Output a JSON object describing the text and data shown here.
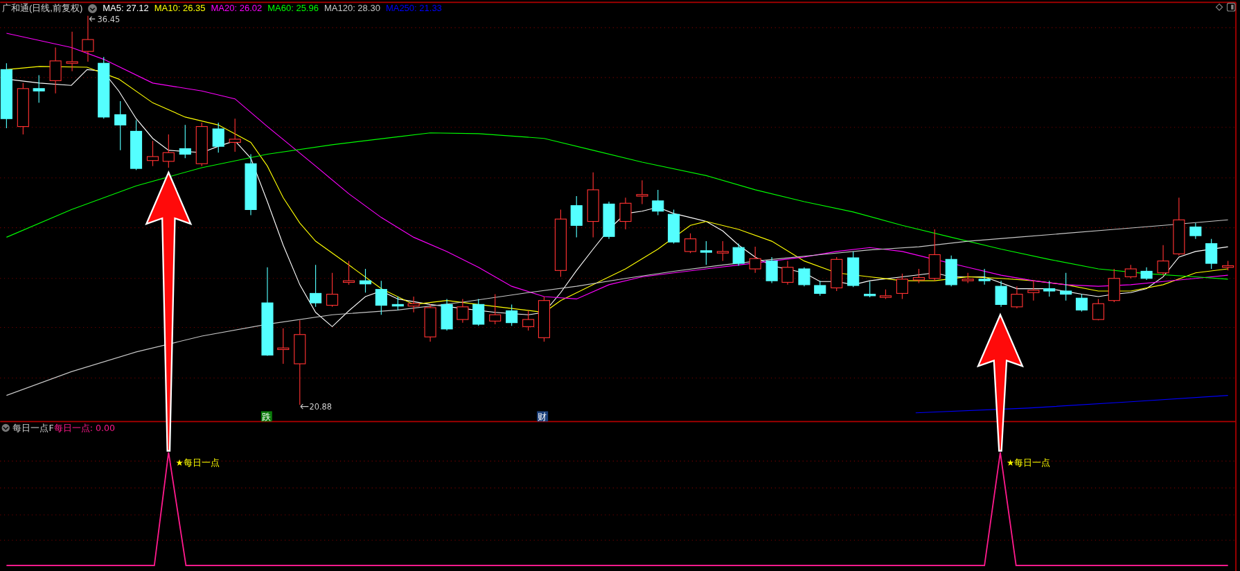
{
  "chart": {
    "title": "广和通(日线,前复权)",
    "ma_legend": [
      {
        "label": "MA5: 27.12",
        "color": "#ffffff"
      },
      {
        "label": "MA10: 26.35",
        "color": "#ffff00"
      },
      {
        "label": "MA20: 26.02",
        "color": "#ff00ff"
      },
      {
        "label": "MA60: 25.96",
        "color": "#00ff00"
      },
      {
        "label": "MA120: 28.30",
        "color": "#c8c8c8"
      },
      {
        "label": "MA250: 21.33",
        "color": "#0000ff"
      }
    ],
    "high_label": "36.45",
    "low_label": "20.88",
    "event_markers": [
      {
        "text": "跌",
        "color": "#0a7a0a"
      },
      {
        "text": "财",
        "color": "#1a3f7a"
      }
    ]
  },
  "indicator": {
    "name": "每日一点F",
    "readout": "每日一点: 0.00",
    "signals": [
      "★每日一点",
      "★每日一点"
    ]
  }
}
